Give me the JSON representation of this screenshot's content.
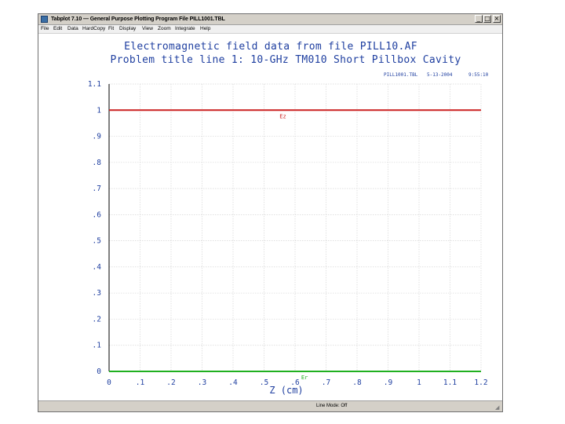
{
  "window": {
    "title": "Tabplot 7.10 — General Purpose Plotting Program   File PILL1001.TBL",
    "controls": {
      "minimize": "_",
      "maximize": "□",
      "close": "×"
    }
  },
  "menu": {
    "items": [
      "File",
      "Edit",
      "Data",
      "HardCopy",
      "Fit",
      "Display",
      "View",
      "Zoom",
      "Integrate",
      "Help"
    ]
  },
  "plot": {
    "title_line1": "Electromagnetic field data from file PILL10.AF",
    "title_line2": "Problem title line 1: 10-GHz TM010 Short Pillbox Cavity",
    "stamp_file": "PILL1001.TBL",
    "stamp_date": "5-13-2004",
    "stamp_time": "9:55:10",
    "colors": {
      "text": "#1f3fa0",
      "grid": "#d6d6d6",
      "axis": "#000000"
    }
  },
  "chart_data": {
    "type": "line",
    "xlabel": "Z (cm)",
    "ylabel": "",
    "xlim": [
      0,
      1.2
    ],
    "ylim": [
      0,
      1.1
    ],
    "x_ticks": [
      0,
      0.1,
      0.2,
      0.3,
      0.4,
      0.5,
      0.6,
      0.7,
      0.8,
      0.9,
      1,
      1.1,
      1.2
    ],
    "x_tick_labels": [
      "0",
      ".1",
      ".2",
      ".3",
      ".4",
      ".5",
      ".6",
      ".7",
      ".8",
      ".9",
      "1",
      "1.1",
      "1.2"
    ],
    "y_ticks": [
      0,
      0.1,
      0.2,
      0.3,
      0.4,
      0.5,
      0.6,
      0.7,
      0.8,
      0.9,
      1,
      1.1
    ],
    "y_tick_labels": [
      "0",
      ".1",
      ".2",
      ".3",
      ".4",
      ".5",
      ".6",
      ".7",
      ".8",
      ".9",
      "1",
      "1.1"
    ],
    "grid": true,
    "series": [
      {
        "name": "Ez",
        "color": "#cc2020",
        "x": [
          0,
          1.2
        ],
        "y": [
          1.0,
          1.0
        ],
        "label_x": 0.55
      },
      {
        "name": "Er",
        "color": "#20b020",
        "x": [
          0,
          1.2
        ],
        "y": [
          0.0,
          0.0
        ],
        "label_x": 0.62
      }
    ]
  },
  "status": {
    "text": "Line Mode: Off"
  }
}
